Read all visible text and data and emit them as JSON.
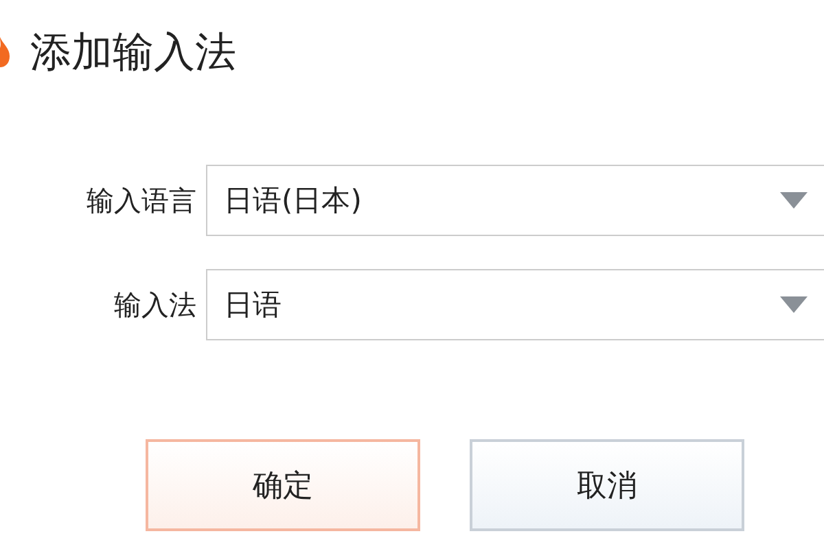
{
  "dialog": {
    "title": "添加输入法"
  },
  "fields": [
    {
      "label": "输入语言",
      "value": "日语(日本)"
    },
    {
      "label": "输入法",
      "value": "日语"
    }
  ],
  "buttons": [
    {
      "label": "确定",
      "kind": "primary"
    },
    {
      "label": "取消",
      "kind": "secondary"
    }
  ]
}
